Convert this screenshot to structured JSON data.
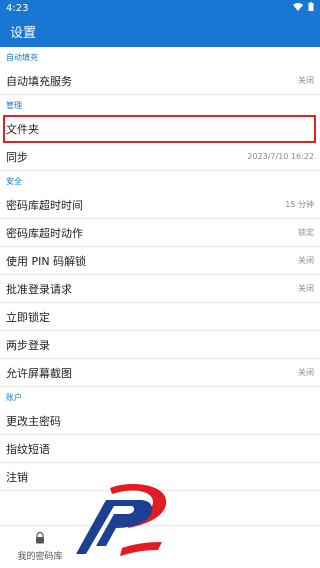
{
  "statusbar": {
    "time": "4:23"
  },
  "appbar": {
    "title": "设置"
  },
  "sections": {
    "autofill": {
      "header": "自动填充",
      "items": [
        {
          "label": "自动填充服务",
          "value": "关闭"
        }
      ]
    },
    "manage": {
      "header": "管理",
      "items": [
        {
          "label": "文件夹",
          "value": ""
        },
        {
          "label": "同步",
          "value": "2023/7/10 16:22"
        }
      ]
    },
    "security": {
      "header": "安全",
      "items": [
        {
          "label": "密码库超时时间",
          "value": "15 分钟"
        },
        {
          "label": "密码库超时动作",
          "value": "锁定"
        },
        {
          "label": "使用 PIN 码解锁",
          "value": "关闭"
        },
        {
          "label": "批准登录请求",
          "value": "关闭"
        },
        {
          "label": "立即锁定",
          "value": ""
        },
        {
          "label": "两步登录",
          "value": ""
        },
        {
          "label": "允许屏幕截图",
          "value": "关闭"
        }
      ]
    },
    "account": {
      "header": "账户",
      "items": [
        {
          "label": "更改主密码",
          "value": ""
        },
        {
          "label": "指纹短语",
          "value": ""
        },
        {
          "label": "注销",
          "value": ""
        }
      ]
    }
  },
  "bottom_nav": {
    "vault_label": "我的密码库"
  },
  "colors": {
    "primary": "#1976d2",
    "highlight": "#e02020",
    "logo_red": "#e31b23",
    "logo_blue": "#1d3f94"
  }
}
